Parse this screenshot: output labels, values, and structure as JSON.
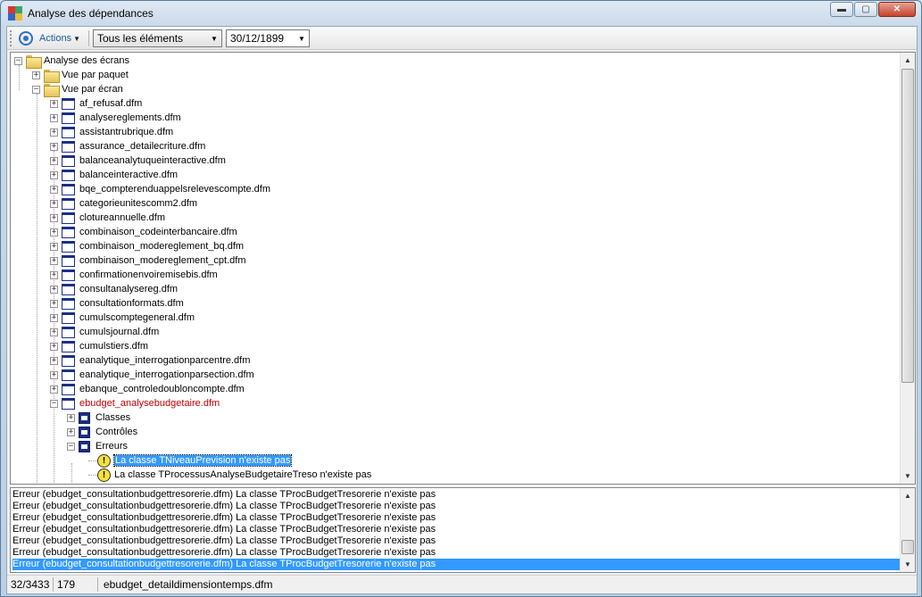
{
  "window": {
    "title": "Analyse des dépendances",
    "minimize_glyph": "▬",
    "maximize_glyph": "▢",
    "close_glyph": "✕"
  },
  "toolbar": {
    "actions_label": "Actions",
    "filter_value": "Tous les éléments",
    "date_value": "30/12/1899"
  },
  "tree": {
    "root": "Analyse des écrans",
    "by_package": "Vue par paquet",
    "by_screen": "Vue par écran",
    "screens": [
      "af_refusaf.dfm",
      "analysereglements.dfm",
      "assistantrubrique.dfm",
      "assurance_detailecriture.dfm",
      "balanceanalytuqueinteractive.dfm",
      "balanceinteractive.dfm",
      "bqe_compterenduappelsrelevescompte.dfm",
      "categorieunitescomm2.dfm",
      "clotureannuelle.dfm",
      "combinaison_codeinterbancaire.dfm",
      "combinaison_modereglement_bq.dfm",
      "combinaison_modereglement_cpt.dfm",
      "confirmationenvoiremisebis.dfm",
      "consultanalysereg.dfm",
      "consultationformats.dfm",
      "cumulscomptegeneral.dfm",
      "cumulsjournal.dfm",
      "cumulstiers.dfm",
      "eanalytique_interrogationparcentre.dfm",
      "eanalytique_interrogationparsection.dfm",
      "ebanque_controledoubloncompte.dfm"
    ],
    "expanded_screen": "ebudget_analysebudgetaire.dfm",
    "categories": [
      "Classes",
      "Contrôles",
      "Erreurs"
    ],
    "errors": [
      "La classe TNiveauPrevision n'existe pas",
      "La classe TProcessusAnalyseBudgetaireTreso n'existe pas"
    ],
    "expander_plus": "+",
    "expander_minus": "−",
    "warn_glyph": "!"
  },
  "log": {
    "lines": [
      "Erreur (ebudget_consultationbudgettresorerie.dfm) La classe TProcBudgetTresorerie n'existe pas",
      "Erreur (ebudget_consultationbudgettresorerie.dfm) La classe TProcBudgetTresorerie n'existe pas",
      "Erreur (ebudget_consultationbudgettresorerie.dfm) La classe TProcBudgetTresorerie n'existe pas",
      "Erreur (ebudget_consultationbudgettresorerie.dfm) La classe TProcBudgetTresorerie n'existe pas",
      "Erreur (ebudget_consultationbudgettresorerie.dfm) La classe TProcBudgetTresorerie n'existe pas",
      "Erreur (ebudget_consultationbudgettresorerie.dfm) La classe TProcBudgetTresorerie n'existe pas",
      "Erreur (ebudget_consultationbudgettresorerie.dfm) La classe TProcBudgetTresorerie n'existe pas"
    ]
  },
  "status": {
    "progress": "32/3433",
    "count": "179",
    "current_file": "ebudget_detaildimensiontemps.dfm"
  },
  "colors": {
    "selection": "#3399ff",
    "error_item": "#c00000",
    "form_icon": "#1b2f86"
  }
}
